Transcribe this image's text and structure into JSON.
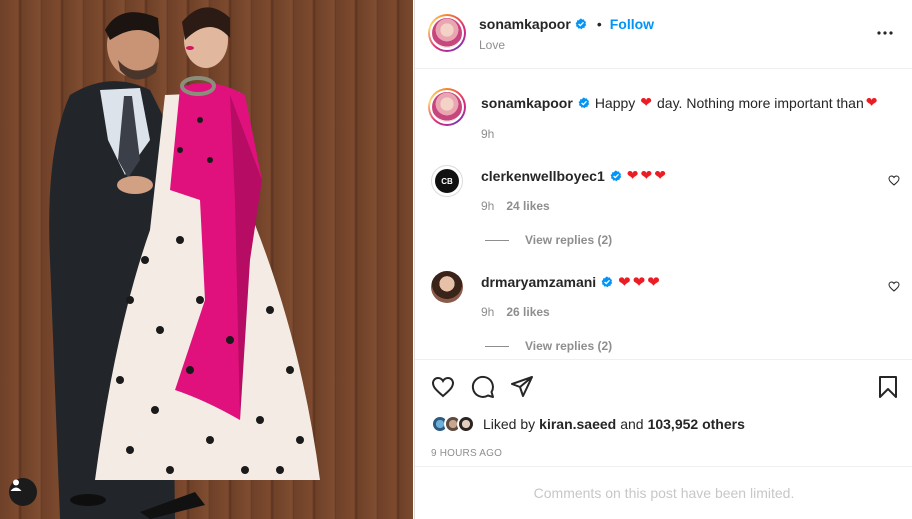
{
  "post": {
    "author": "sonamkapoor",
    "follow_label": "Follow",
    "separator": "•",
    "location": "Love",
    "more_icon": "more-horizontal-icon"
  },
  "caption": {
    "author": "sonamkapoor",
    "text_before": "Happy",
    "text_middle": "day. Nothing more important than",
    "emoji_1": "❤",
    "emoji_2": "❤",
    "time": "9h"
  },
  "comments": [
    {
      "author": "clerkenwellboyec1",
      "emojis": "❤❤❤",
      "time": "9h",
      "likes": "24 likes",
      "replies": "View replies (2)"
    },
    {
      "author": "drmaryamzamani",
      "emojis": "❤❤❤",
      "time": "9h",
      "likes": "26 likes",
      "replies": "View replies (2)"
    }
  ],
  "actions": {
    "liked_by_prefix": "Liked by",
    "liked_by_user": "kiran.saeed",
    "liked_by_and": "and",
    "liked_by_count": "103,952 others",
    "timestamp": "9 HOURS AGO"
  },
  "footer": {
    "limited_text": "Comments on this post have been limited."
  },
  "colors": {
    "accent": "#0095f6",
    "heart": "#ed1c24",
    "muted": "#8e8e8e",
    "text": "#262626"
  }
}
